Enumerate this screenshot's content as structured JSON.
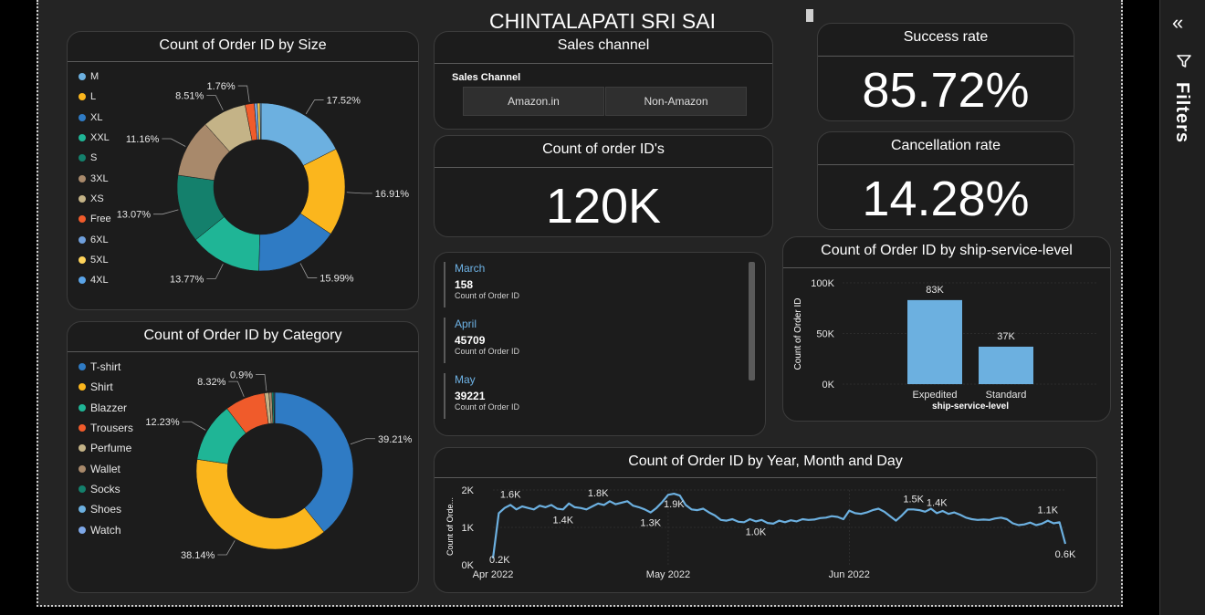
{
  "dashboard": {
    "title": "CHINTALAPATI SRI SAI"
  },
  "filters_pane": {
    "label": "Filters",
    "collapse_icon": "double-chevron-left-icon",
    "filter_icon": "funnel-icon"
  },
  "size_chart": {
    "title": "Count of Order ID by Size",
    "chart_data": {
      "type": "pie",
      "variant": "donut",
      "title": "Count of Order ID by Size",
      "legend_position": "left",
      "labels": [
        "M",
        "L",
        "XL",
        "XXL",
        "S",
        "3XL",
        "XS",
        "Free",
        "6XL",
        "5XL",
        "4XL"
      ],
      "values": [
        17.52,
        16.91,
        15.99,
        13.77,
        13.07,
        11.16,
        8.51,
        1.76,
        0.6,
        0.5,
        0.2
      ],
      "data_labels": [
        "17.52%",
        "16.91%",
        "15.99%",
        "13.77%",
        "13.07%",
        "11.16%",
        "8.51%",
        "1.76%",
        "",
        "",
        ""
      ],
      "colors": [
        "#6cb0e0",
        "#fbb61d",
        "#2f7bc4",
        "#1fb596",
        "#14806c",
        "#a8896b",
        "#c4b387",
        "#f05b2b",
        "#6f9fdc",
        "#ffd45a",
        "#5aa4e8"
      ]
    }
  },
  "category_chart": {
    "title": "Count of Order ID by Category",
    "chart_data": {
      "type": "pie",
      "variant": "donut",
      "title": "Count of Order ID by Category",
      "legend_position": "left",
      "labels": [
        "T-shirt",
        "Shirt",
        "Blazzer",
        "Trousers",
        "Perfume",
        "Wallet",
        "Socks",
        "Shoes",
        "Watch"
      ],
      "values": [
        39.21,
        38.14,
        12.23,
        8.32,
        0.9,
        0.6,
        0.4,
        0.1,
        0.1
      ],
      "data_labels": [
        "39.21%",
        "38.14%",
        "12.23%",
        "8.32%",
        "0.9%",
        "",
        "",
        "",
        ""
      ],
      "colors": [
        "#2f7bc4",
        "#fbb61d",
        "#1fb596",
        "#f05b2b",
        "#c4b387",
        "#a8896b",
        "#14806c",
        "#6cb0e0",
        "#7ea8e8"
      ]
    }
  },
  "sales_channel": {
    "title": "Sales channel",
    "slicer_header": "Sales Channel",
    "options": [
      "Amazon.in",
      "Non-Amazon"
    ]
  },
  "order_count": {
    "title": "Count of order ID's",
    "value": "120K"
  },
  "monthly_cards": [
    {
      "month": "March",
      "value": "158",
      "caption": "Count of Order ID"
    },
    {
      "month": "April",
      "value": "45709",
      "caption": "Count of Order ID"
    },
    {
      "month": "May",
      "value": "39221",
      "caption": "Count of Order ID"
    }
  ],
  "success_rate": {
    "title": "Success rate",
    "value": "85.72%"
  },
  "cancellation_rate": {
    "title": "Cancellation rate",
    "value": "14.28%"
  },
  "ship_chart": {
    "title": "Count of Order ID by ship-service-level",
    "chart_data": {
      "type": "bar",
      "title": "Count of Order ID by ship-service-level",
      "categories": [
        "Expedited",
        "Standard"
      ],
      "values": [
        83000,
        37000
      ],
      "data_labels": [
        "83K",
        "37K"
      ],
      "xlabel": "ship-service-level",
      "ylabel": "Count of Order ID",
      "ylim": [
        0,
        100000
      ],
      "yticks": [
        {
          "v": 0,
          "label": "0K"
        },
        {
          "v": 50000,
          "label": "50K"
        },
        {
          "v": 100000,
          "label": "100K"
        }
      ],
      "color": "#6cb0e0"
    }
  },
  "trend_chart": {
    "title": "Count of Order ID by Year, Month and Day",
    "chart_data": {
      "type": "line",
      "title": "Count of Order ID by Year, Month and Day",
      "ylabel": "Count of Orde...",
      "ylim": [
        0,
        2000
      ],
      "yticks": [
        {
          "v": 0,
          "label": "0K"
        },
        {
          "v": 1000,
          "label": "1K"
        },
        {
          "v": 2000,
          "label": "2K"
        }
      ],
      "xticks": [
        {
          "i": 0,
          "label": "Apr 2022"
        },
        {
          "i": 30,
          "label": "May 2022"
        },
        {
          "i": 61,
          "label": "Jun 2022"
        }
      ],
      "color": "#6cb0e0",
      "y": [
        170,
        1380,
        1520,
        1600,
        1480,
        1560,
        1520,
        1480,
        1580,
        1540,
        1600,
        1500,
        1480,
        1640,
        1540,
        1520,
        1480,
        1560,
        1640,
        1600,
        1700,
        1620,
        1660,
        1700,
        1580,
        1540,
        1480,
        1400,
        1520,
        1680,
        1870,
        1900,
        1850,
        1600,
        1480,
        1460,
        1500,
        1400,
        1320,
        1200,
        1180,
        1220,
        1150,
        1140,
        1220,
        1160,
        1200,
        1120,
        1100,
        1180,
        1140,
        1190,
        1160,
        1220,
        1200,
        1210,
        1250,
        1260,
        1300,
        1280,
        1220,
        1450,
        1380,
        1360,
        1400,
        1460,
        1500,
        1420,
        1300,
        1180,
        1320,
        1480,
        1480,
        1460,
        1420,
        1500,
        1380,
        1440,
        1360,
        1400,
        1340,
        1260,
        1220,
        1200,
        1210,
        1200,
        1240,
        1260,
        1220,
        1110,
        1060,
        1080,
        1130,
        1060,
        1100,
        1180,
        1110,
        1140,
        560
      ],
      "annotations": [
        {
          "i": 0,
          "label": "0.2K",
          "pos": "right"
        },
        {
          "i": 3,
          "label": "1.6K",
          "pos": "above"
        },
        {
          "i": 12,
          "label": "1.4K",
          "pos": "below"
        },
        {
          "i": 18,
          "label": "1.8K",
          "pos": "above"
        },
        {
          "i": 27,
          "label": "1.3K",
          "pos": "below"
        },
        {
          "i": 31,
          "label": "1.9K",
          "pos": "below"
        },
        {
          "i": 45,
          "label": "1.0K",
          "pos": "below"
        },
        {
          "i": 72,
          "label": "1.5K",
          "pos": "above"
        },
        {
          "i": 76,
          "label": "1.4K",
          "pos": "above"
        },
        {
          "i": 95,
          "label": "1.1K",
          "pos": "above"
        },
        {
          "i": 98,
          "label": "0.6K",
          "pos": "below"
        }
      ]
    }
  }
}
